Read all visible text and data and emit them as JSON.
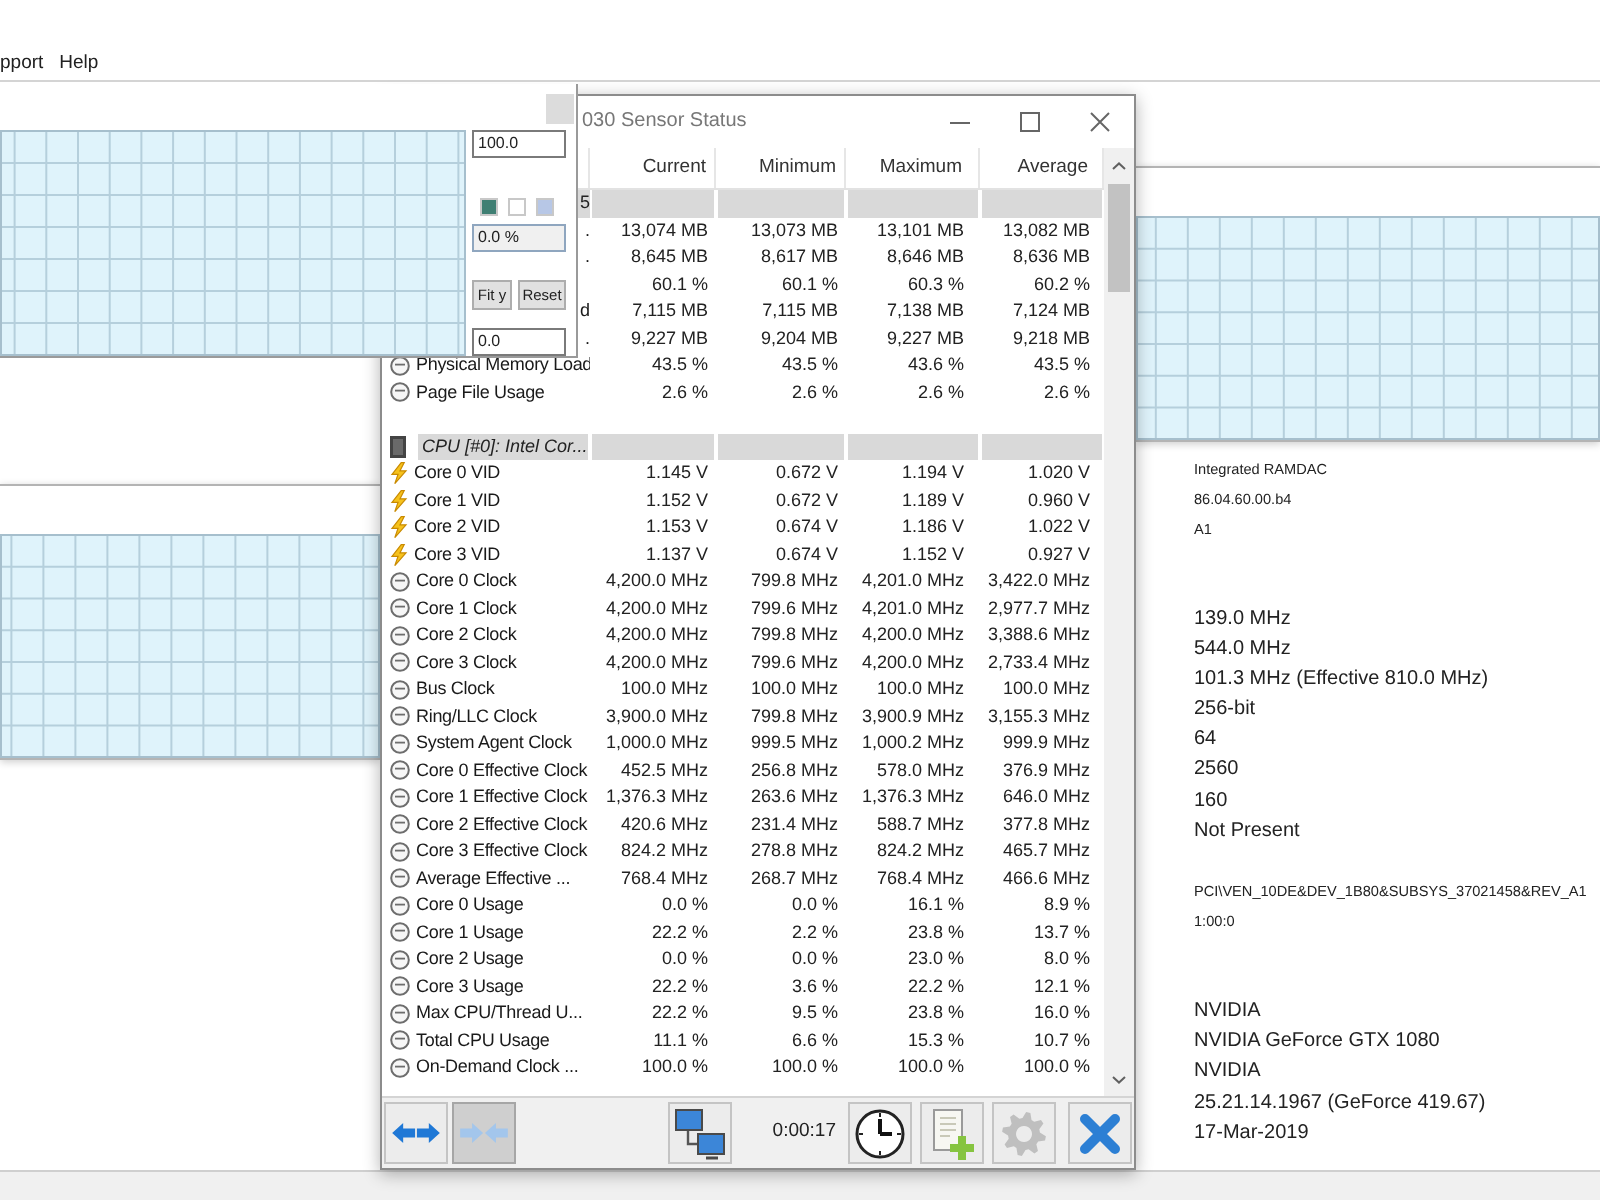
{
  "menu": [
    {
      "label": "pport"
    },
    {
      "label": "Help"
    }
  ],
  "graph_window": {
    "max_value": "100.0",
    "swatches": [
      {
        "color": "#3f7f73"
      },
      {
        "color": "#ffffff"
      },
      {
        "color": "#b7c7e6"
      }
    ],
    "reading": "0.0 %",
    "buttons": [
      {
        "label": "Fit y"
      },
      {
        "label": "Reset"
      }
    ],
    "min_value": "0.0"
  },
  "sensor_window": {
    "title": "030 Sensor Status",
    "columns": [
      "Current",
      "Minimum",
      "Maximum",
      "Average"
    ],
    "groups": [
      {
        "name_tail": "5",
        "rows": [
          {
            "name_tail": ".",
            "values": [
              "13,074 MB",
              "13,073 MB",
              "13,101 MB",
              "13,082 MB"
            ]
          },
          {
            "name_tail": ".",
            "values": [
              "8,645 MB",
              "8,617 MB",
              "8,646 MB",
              "8,636 MB"
            ]
          },
          {
            "values": [
              "60.1 %",
              "60.1 %",
              "60.3 %",
              "60.2 %"
            ]
          },
          {
            "name_tail": "d",
            "values": [
              "7,115 MB",
              "7,115 MB",
              "7,138 MB",
              "7,124 MB"
            ]
          },
          {
            "name_tail": ".",
            "values": [
              "9,227 MB",
              "9,204 MB",
              "9,227 MB",
              "9,218 MB"
            ]
          },
          {
            "name": "Physical Memory Load",
            "kind": "reading",
            "values": [
              "43.5 %",
              "43.5 %",
              "43.6 %",
              "43.5 %"
            ]
          },
          {
            "name": "Page File Usage",
            "kind": "reading",
            "values": [
              "2.6 %",
              "2.6 %",
              "2.6 %",
              "2.6 %"
            ]
          }
        ]
      },
      {
        "name": "CPU [#0]: Intel Cor...",
        "rows": [
          {
            "name": "Core 0 VID",
            "kind": "voltage",
            "values": [
              "1.145 V",
              "0.672 V",
              "1.194 V",
              "1.020 V"
            ]
          },
          {
            "name": "Core 1 VID",
            "kind": "voltage",
            "values": [
              "1.152 V",
              "0.672 V",
              "1.189 V",
              "0.960 V"
            ]
          },
          {
            "name": "Core 2 VID",
            "kind": "voltage",
            "values": [
              "1.153 V",
              "0.674 V",
              "1.186 V",
              "1.022 V"
            ]
          },
          {
            "name": "Core 3 VID",
            "kind": "voltage",
            "values": [
              "1.137 V",
              "0.674 V",
              "1.152 V",
              "0.927 V"
            ]
          },
          {
            "name": "Core 0 Clock",
            "kind": "reading",
            "values": [
              "4,200.0 MHz",
              "799.8 MHz",
              "4,201.0 MHz",
              "3,422.0 MHz"
            ]
          },
          {
            "name": "Core 1 Clock",
            "kind": "reading",
            "values": [
              "4,200.0 MHz",
              "799.6 MHz",
              "4,201.0 MHz",
              "2,977.7 MHz"
            ]
          },
          {
            "name": "Core 2 Clock",
            "kind": "reading",
            "values": [
              "4,200.0 MHz",
              "799.8 MHz",
              "4,200.0 MHz",
              "3,388.6 MHz"
            ]
          },
          {
            "name": "Core 3 Clock",
            "kind": "reading",
            "values": [
              "4,200.0 MHz",
              "799.6 MHz",
              "4,200.0 MHz",
              "2,733.4 MHz"
            ]
          },
          {
            "name": "Bus Clock",
            "kind": "reading",
            "values": [
              "100.0 MHz",
              "100.0 MHz",
              "100.0 MHz",
              "100.0 MHz"
            ]
          },
          {
            "name": "Ring/LLC Clock",
            "kind": "reading",
            "values": [
              "3,900.0 MHz",
              "799.8 MHz",
              "3,900.9 MHz",
              "3,155.3 MHz"
            ]
          },
          {
            "name": "System Agent Clock",
            "kind": "reading",
            "values": [
              "1,000.0 MHz",
              "999.5 MHz",
              "1,000.2 MHz",
              "999.9 MHz"
            ]
          },
          {
            "name": "Core 0 Effective Clock",
            "kind": "reading",
            "values": [
              "452.5 MHz",
              "256.8 MHz",
              "578.0 MHz",
              "376.9 MHz"
            ]
          },
          {
            "name": "Core 1 Effective Clock",
            "kind": "reading",
            "values": [
              "1,376.3 MHz",
              "263.6 MHz",
              "1,376.3 MHz",
              "646.0 MHz"
            ]
          },
          {
            "name": "Core 2 Effective Clock",
            "kind": "reading",
            "values": [
              "420.6 MHz",
              "231.4 MHz",
              "588.7 MHz",
              "377.8 MHz"
            ]
          },
          {
            "name": "Core 3 Effective Clock",
            "kind": "reading",
            "values": [
              "824.2 MHz",
              "278.8 MHz",
              "824.2 MHz",
              "465.7 MHz"
            ]
          },
          {
            "name": "Average Effective ...",
            "kind": "reading",
            "values": [
              "768.4 MHz",
              "268.7 MHz",
              "768.4 MHz",
              "466.6 MHz"
            ]
          },
          {
            "name": "Core 0 Usage",
            "kind": "reading",
            "values": [
              "0.0 %",
              "0.0 %",
              "16.1 %",
              "8.9 %"
            ]
          },
          {
            "name": "Core 1 Usage",
            "kind": "reading",
            "values": [
              "22.2 %",
              "2.2 %",
              "23.8 %",
              "13.7 %"
            ]
          },
          {
            "name": "Core 2 Usage",
            "kind": "reading",
            "values": [
              "0.0 %",
              "0.0 %",
              "23.0 %",
              "8.0 %"
            ]
          },
          {
            "name": "Core 3 Usage",
            "kind": "reading",
            "values": [
              "22.2 %",
              "3.6 %",
              "22.2 %",
              "12.1 %"
            ]
          },
          {
            "name": "Max CPU/Thread U...",
            "kind": "reading",
            "values": [
              "22.2 %",
              "9.5 %",
              "23.8 %",
              "16.0 %"
            ]
          },
          {
            "name": "Total CPU Usage",
            "kind": "reading",
            "values": [
              "11.1 %",
              "6.6 %",
              "15.3 %",
              "10.7 %"
            ]
          },
          {
            "name": "On-Demand Clock ...",
            "kind": "reading",
            "values": [
              "100.0 %",
              "100.0 %",
              "100.0 %",
              "100.0 %"
            ]
          }
        ]
      }
    ],
    "toolbar": {
      "left": [
        {
          "kind": "expand",
          "pressed": false,
          "disabled": false
        },
        {
          "kind": "collapse",
          "pressed": true,
          "disabled": false
        }
      ],
      "right": [
        {
          "kind": "network",
          "pressed": false,
          "disabled": false
        },
        {
          "kind": "timer",
          "text": "0:00:17"
        },
        {
          "kind": "clock",
          "pressed": false,
          "disabled": false
        },
        {
          "kind": "report",
          "pressed": false,
          "disabled": false
        },
        {
          "kind": "settings",
          "pressed": false,
          "disabled": true
        },
        {
          "kind": "close",
          "pressed": false,
          "disabled": false
        }
      ]
    }
  },
  "details": [
    {
      "kind": "compact",
      "text": "Integrated RAMDAC"
    },
    {
      "kind": "compact",
      "text": "86.04.60.00.b4"
    },
    {
      "kind": "compact",
      "text": "A1"
    },
    {
      "kind": "spacer"
    },
    {
      "kind": "spacer"
    },
    {
      "kind": "value",
      "text": "139.0 MHz"
    },
    {
      "kind": "value",
      "text": "544.0 MHz"
    },
    {
      "kind": "value",
      "text": "101.3 MHz (Effective 810.0 MHz)"
    },
    {
      "kind": "value",
      "text": "256-bit"
    },
    {
      "kind": "value",
      "text": "64"
    },
    {
      "kind": "value",
      "text": "2560"
    },
    {
      "kind": "value",
      "text": "160"
    },
    {
      "kind": "value",
      "text": "Not Present"
    },
    {
      "kind": "spacer"
    },
    {
      "kind": "compact",
      "text": "PCI\\VEN_10DE&DEV_1B80&SUBSYS_37021458&REV_A1"
    },
    {
      "kind": "compact",
      "text": "1:00:0"
    },
    {
      "kind": "spacer"
    },
    {
      "kind": "spacer"
    },
    {
      "kind": "value",
      "text": "NVIDIA"
    },
    {
      "kind": "value",
      "text": "NVIDIA GeForce GTX 1080"
    },
    {
      "kind": "value",
      "text": "NVIDIA"
    },
    {
      "kind": "value",
      "text": "25.21.14.1967 (GeForce 419.67)"
    },
    {
      "kind": "value",
      "text": "17-Mar-2019"
    }
  ]
}
